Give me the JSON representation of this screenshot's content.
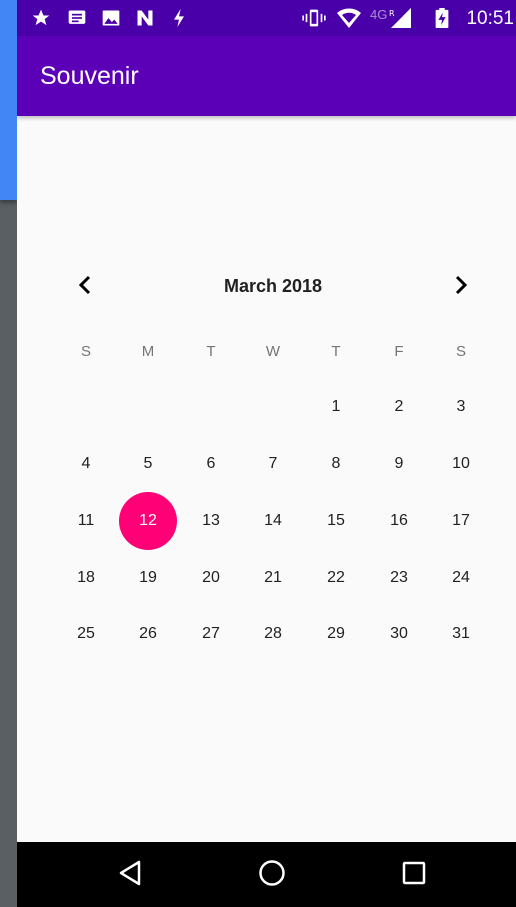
{
  "status_bar": {
    "network": "4G",
    "time": "10:51",
    "left_icons": [
      "star-icon",
      "message-icon",
      "image-icon",
      "n-app-icon",
      "bolt-icon"
    ],
    "right_icons": [
      "vibrate-icon",
      "wifi-icon",
      "signal-icon",
      "battery-charging-icon"
    ]
  },
  "app_bar": {
    "title": "Souvenir"
  },
  "calendar": {
    "month_label": "March 2018",
    "prev_icon": "chevron-left-icon",
    "next_icon": "chevron-right-icon",
    "weekdays": [
      "S",
      "M",
      "T",
      "W",
      "T",
      "F",
      "S"
    ],
    "first_weekday_index": 4,
    "days": [
      "1",
      "2",
      "3",
      "4",
      "5",
      "6",
      "7",
      "8",
      "9",
      "10",
      "11",
      "12",
      "13",
      "14",
      "15",
      "16",
      "17",
      "18",
      "19",
      "20",
      "21",
      "22",
      "23",
      "24",
      "25",
      "26",
      "27",
      "28",
      "29",
      "30",
      "31"
    ],
    "selected_day": "12",
    "selected_color": "#ff0077"
  },
  "nav_bar": {
    "icons": [
      "back-icon",
      "home-icon",
      "recents-icon"
    ]
  },
  "colors": {
    "status_bar": "#4a00a8",
    "app_bar": "#5c00b8",
    "background": "#fafafa"
  }
}
